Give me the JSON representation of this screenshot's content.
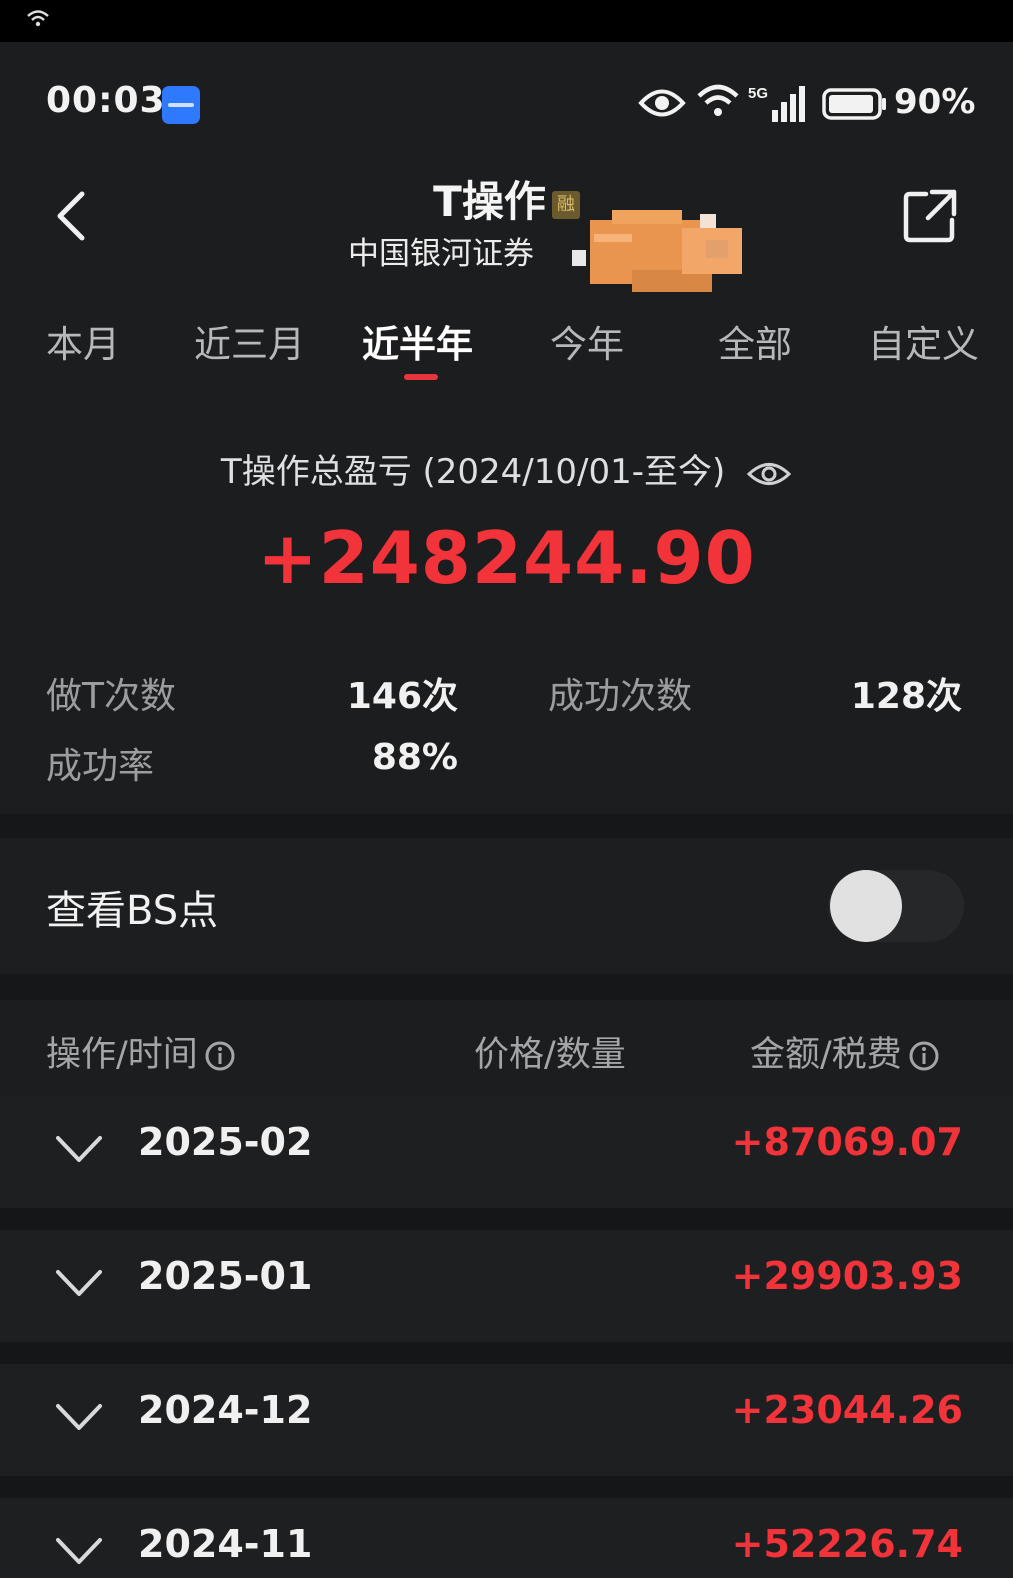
{
  "status_bar": {
    "time": "00:03",
    "battery": "90%",
    "network": "5G"
  },
  "header": {
    "title": "T操作",
    "title_badge": "融",
    "broker": "中国银河证券"
  },
  "tabs": [
    {
      "label": "本月",
      "active": false
    },
    {
      "label": "近三月",
      "active": false
    },
    {
      "label": "近半年",
      "active": true
    },
    {
      "label": "今年",
      "active": false
    },
    {
      "label": "全部",
      "active": false
    },
    {
      "label": "自定义",
      "active": false
    }
  ],
  "summary": {
    "label": "T操作总盈亏 (2024/10/01-至今)",
    "total": "+248244.90"
  },
  "stats": {
    "t_count_label": "做T次数",
    "t_count_value": "146次",
    "success_count_label": "成功次数",
    "success_count_value": "128次",
    "success_rate_label": "成功率",
    "success_rate_value": "88%"
  },
  "bs_points": {
    "label": "查看BS点",
    "enabled": false
  },
  "table": {
    "col_op_time": "操作/时间",
    "col_price_qty": "价格/数量",
    "col_amount_fee": "金额/税费"
  },
  "months": [
    {
      "month": "2025-02",
      "amount": "+87069.07"
    },
    {
      "month": "2025-01",
      "amount": "+29903.93"
    },
    {
      "month": "2024-12",
      "amount": "+23044.26"
    },
    {
      "month": "2024-11",
      "amount": "+52226.74"
    }
  ],
  "colors": {
    "background": "#1c1d1f",
    "profit_red": "#f2333a",
    "tab_indicator": "#e8343b",
    "badge_blue": "#2f79ff"
  }
}
